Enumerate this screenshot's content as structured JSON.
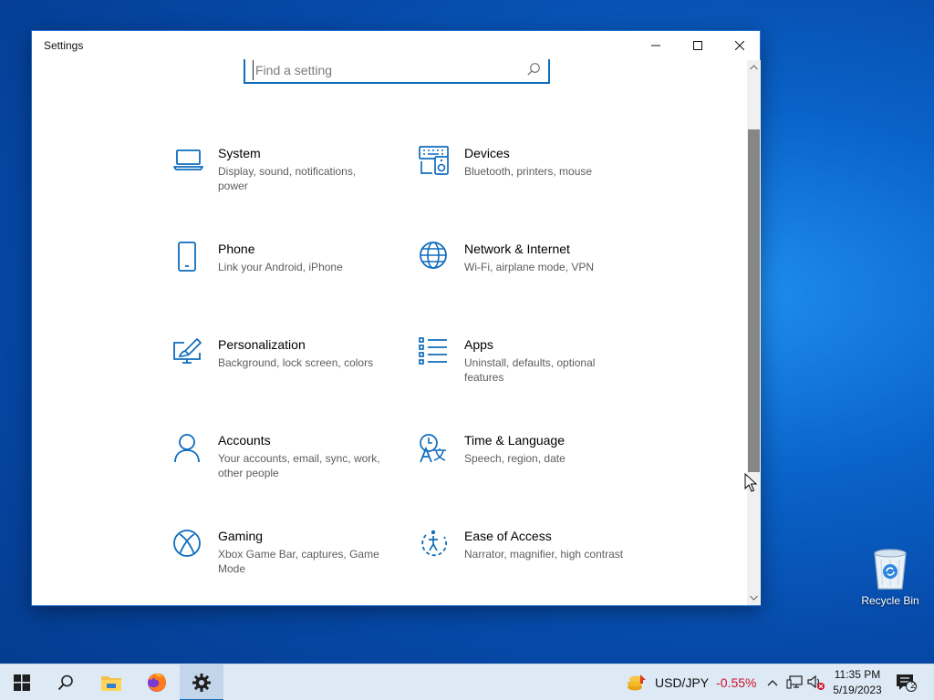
{
  "window": {
    "title": "Settings",
    "search": {
      "placeholder": "Find a setting",
      "value": ""
    }
  },
  "tiles": [
    {
      "name": "System",
      "desc": "Display, sound, notifications, power",
      "icon": "laptop-icon"
    },
    {
      "name": "Devices",
      "desc": "Bluetooth, printers, mouse",
      "icon": "keyboard-speaker-icon"
    },
    {
      "name": "Phone",
      "desc": "Link your Android, iPhone",
      "icon": "phone-icon"
    },
    {
      "name": "Network & Internet",
      "desc": "Wi-Fi, airplane mode, VPN",
      "icon": "globe-icon"
    },
    {
      "name": "Personalization",
      "desc": "Background, lock screen, colors",
      "icon": "paint-brush-icon"
    },
    {
      "name": "Apps",
      "desc": "Uninstall, defaults, optional features",
      "icon": "app-list-icon"
    },
    {
      "name": "Accounts",
      "desc": "Your accounts, email, sync, work, other people",
      "icon": "person-icon"
    },
    {
      "name": "Time & Language",
      "desc": "Speech, region, date",
      "icon": "time-language-icon"
    },
    {
      "name": "Gaming",
      "desc": "Xbox Game Bar, captures, Game Mode",
      "icon": "xbox-icon"
    },
    {
      "name": "Ease of Access",
      "desc": "Narrator, magnifier, high contrast",
      "icon": "ease-of-access-icon"
    }
  ],
  "desktop": {
    "recycle_bin_label": "Recycle Bin"
  },
  "taskbar": {
    "currency_pair": "USD/JPY",
    "currency_change": "-0.55%",
    "time": "11:35 PM",
    "date": "5/19/2023",
    "notification_count": "2"
  },
  "colors": {
    "accent": "#0f6cbd",
    "negative": "#d0132a"
  }
}
